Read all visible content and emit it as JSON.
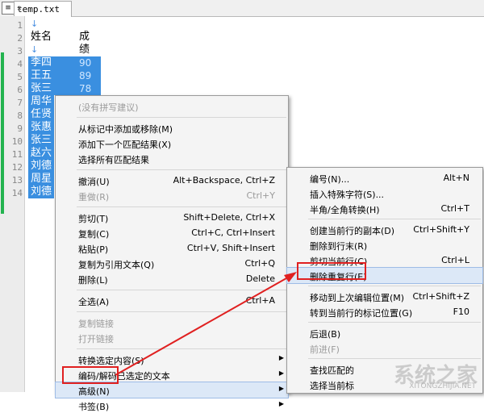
{
  "tab": {
    "icon": "notepad-icon",
    "filename": "temp.txt",
    "close": "✕"
  },
  "line_numbers": [
    "1",
    "2",
    "3",
    "4",
    "5",
    "6",
    "7",
    "8",
    "9",
    "10",
    "11",
    "12",
    "13",
    "14"
  ],
  "doc": {
    "line1": "↓",
    "header_name": "姓名",
    "header_score": "成绩↓",
    "line3": "↓",
    "rows": [
      {
        "name": "李四",
        "score": "90"
      },
      {
        "name": "王五",
        "score": "89"
      },
      {
        "name": "张三",
        "score": "78"
      },
      {
        "name": "周华",
        "score": ""
      },
      {
        "name": "任贤",
        "score": ""
      },
      {
        "name": "张惠",
        "score": ""
      },
      {
        "name": "张三",
        "score": ""
      },
      {
        "name": "赵六",
        "score": ""
      },
      {
        "name": "刘德",
        "score": ""
      },
      {
        "name": "周星",
        "score": ""
      },
      {
        "name": "刘德",
        "score": ""
      }
    ]
  },
  "context_menu": {
    "items": [
      {
        "label": "(没有拼写建议)",
        "shortcut": "",
        "disabled": true,
        "sep_before": false,
        "submenu": false
      },
      {
        "label": "从标记中添加或移除(M)",
        "shortcut": "",
        "disabled": false,
        "sep_before": true,
        "submenu": false
      },
      {
        "label": "添加下一个匹配结果(X)",
        "shortcut": "",
        "disabled": false,
        "sep_before": false,
        "submenu": false
      },
      {
        "label": "选择所有匹配结果",
        "shortcut": "",
        "disabled": false,
        "sep_before": false,
        "submenu": false
      },
      {
        "label": "撤消(U)",
        "shortcut": "Alt+Backspace, Ctrl+Z",
        "disabled": false,
        "sep_before": true,
        "submenu": false
      },
      {
        "label": "重做(R)",
        "shortcut": "Ctrl+Y",
        "disabled": true,
        "sep_before": false,
        "submenu": false
      },
      {
        "label": "剪切(T)",
        "shortcut": "Shift+Delete, Ctrl+X",
        "disabled": false,
        "sep_before": true,
        "submenu": false
      },
      {
        "label": "复制(C)",
        "shortcut": "Ctrl+C, Ctrl+Insert",
        "disabled": false,
        "sep_before": false,
        "submenu": false
      },
      {
        "label": "粘贴(P)",
        "shortcut": "Ctrl+V, Shift+Insert",
        "disabled": false,
        "sep_before": false,
        "submenu": false
      },
      {
        "label": "复制为引用文本(Q)",
        "shortcut": "Ctrl+Q",
        "disabled": false,
        "sep_before": false,
        "submenu": false
      },
      {
        "label": "删除(L)",
        "shortcut": "Delete",
        "disabled": false,
        "sep_before": false,
        "submenu": false
      },
      {
        "label": "全选(A)",
        "shortcut": "Ctrl+A",
        "disabled": false,
        "sep_before": true,
        "submenu": false
      },
      {
        "label": "复制链接",
        "shortcut": "",
        "disabled": true,
        "sep_before": true,
        "submenu": false
      },
      {
        "label": "打开链接",
        "shortcut": "",
        "disabled": true,
        "sep_before": false,
        "submenu": false
      },
      {
        "label": "转换选定内容(S)",
        "shortcut": "",
        "disabled": false,
        "sep_before": true,
        "submenu": true
      },
      {
        "label": "编码/解码已选定的文本",
        "shortcut": "",
        "disabled": false,
        "sep_before": false,
        "submenu": true
      },
      {
        "label": "高级(N)",
        "shortcut": "",
        "disabled": false,
        "sep_before": false,
        "submenu": true,
        "highlight": true
      },
      {
        "label": "书签(B)",
        "shortcut": "",
        "disabled": false,
        "sep_before": false,
        "submenu": true
      }
    ]
  },
  "submenu": {
    "items": [
      {
        "label": "编号(N)...",
        "shortcut": "Alt+N",
        "disabled": false,
        "sep_before": false
      },
      {
        "label": "插入特殊字符(S)...",
        "shortcut": "",
        "disabled": false,
        "sep_before": false
      },
      {
        "label": "半角/全角转换(H)",
        "shortcut": "Ctrl+T",
        "disabled": false,
        "sep_before": false
      },
      {
        "label": "创建当前行的副本(D)",
        "shortcut": "Ctrl+Shift+Y",
        "disabled": false,
        "sep_before": true
      },
      {
        "label": "删除到行末(R)",
        "shortcut": "",
        "disabled": false,
        "sep_before": false
      },
      {
        "label": "剪切当前行(C)",
        "shortcut": "Ctrl+L",
        "disabled": false,
        "sep_before": false
      },
      {
        "label": "删除重复行(E)",
        "shortcut": "",
        "disabled": false,
        "sep_before": false,
        "highlight": true
      },
      {
        "label": "移动到上次编辑位置(M)",
        "shortcut": "Ctrl+Shift+Z",
        "disabled": false,
        "sep_before": true
      },
      {
        "label": "转到当前行的标记位置(G)",
        "shortcut": "F10",
        "disabled": false,
        "sep_before": false
      },
      {
        "label": "后退(B)",
        "shortcut": "",
        "disabled": false,
        "sep_before": true
      },
      {
        "label": "前进(F)",
        "shortcut": "",
        "disabled": true,
        "sep_before": false
      },
      {
        "label": "查找匹配的",
        "shortcut": "",
        "disabled": false,
        "sep_before": true
      },
      {
        "label": "选择当前标",
        "shortcut": "",
        "disabled": false,
        "sep_before": false
      }
    ]
  },
  "watermark": {
    "main": "系统之家",
    "sub": "XITONGZHIJIA.NET"
  },
  "colors": {
    "selection": "#3a8fe0",
    "change_bar": "#23b34f",
    "annotation": "#e02020"
  }
}
